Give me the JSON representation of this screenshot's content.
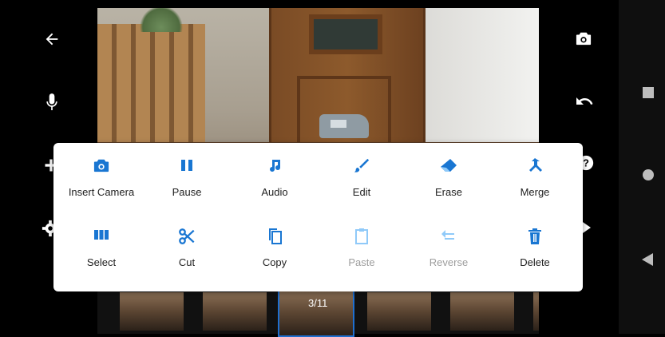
{
  "preview": {
    "camera_overlay": "3/11"
  },
  "left_bar": {
    "icons": [
      "back-arrow-icon",
      "microphone-icon",
      "plus-icon",
      "settings-icon"
    ]
  },
  "right_bar": {
    "icons": [
      "camera-icon",
      "undo-icon",
      "help-icon",
      "play-icon"
    ]
  },
  "nav_bar": {
    "icons": [
      "recents-square-icon",
      "home-circle-icon",
      "back-triangle-icon"
    ]
  },
  "menu": {
    "accent": "#1976d2",
    "items": [
      {
        "label": "Insert Camera",
        "icon": "camera-icon",
        "enabled": true
      },
      {
        "label": "Pause",
        "icon": "pause-icon",
        "enabled": true
      },
      {
        "label": "Audio",
        "icon": "music-note-icon",
        "enabled": true
      },
      {
        "label": "Edit",
        "icon": "brush-icon",
        "enabled": true
      },
      {
        "label": "Erase",
        "icon": "eraser-icon",
        "enabled": true
      },
      {
        "label": "Merge",
        "icon": "merge-icon",
        "enabled": true
      },
      {
        "label": "Select",
        "icon": "select-columns-icon",
        "enabled": true
      },
      {
        "label": "Cut",
        "icon": "scissors-icon",
        "enabled": true
      },
      {
        "label": "Copy",
        "icon": "copy-icon",
        "enabled": true
      },
      {
        "label": "Paste",
        "icon": "clipboard-icon",
        "enabled": false
      },
      {
        "label": "Reverse",
        "icon": "reverse-icon",
        "enabled": false
      },
      {
        "label": "Delete",
        "icon": "trash-icon",
        "enabled": true
      }
    ]
  }
}
